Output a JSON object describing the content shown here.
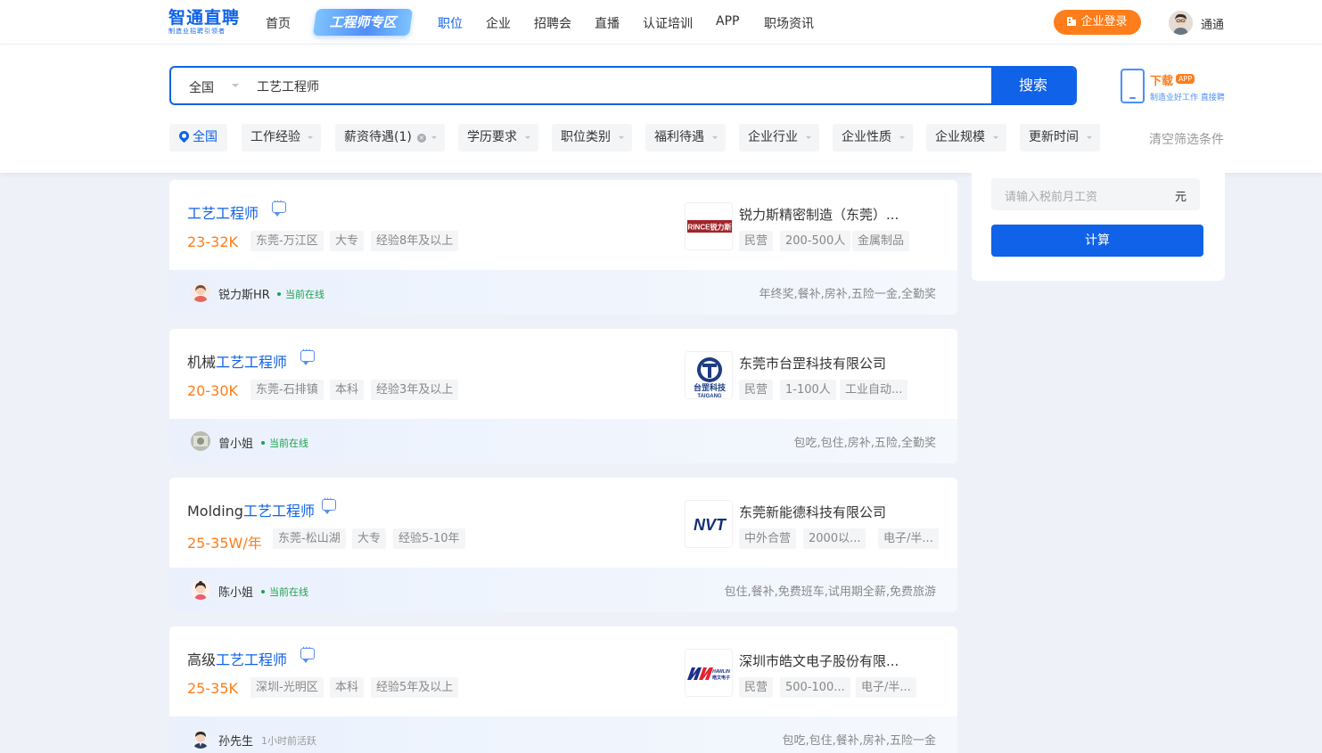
{
  "logo": {
    "main": "智通直聘",
    "sub": "制造业招聘引领者"
  },
  "nav": [
    {
      "label": "首页",
      "active": false
    },
    {
      "label": "职位",
      "active": true
    },
    {
      "label": "企业",
      "active": false
    },
    {
      "label": "招聘会",
      "active": false
    },
    {
      "label": "直播",
      "active": false
    },
    {
      "label": "认证培训",
      "active": false
    },
    {
      "label": "APP",
      "active": false
    },
    {
      "label": "职场资讯",
      "active": false
    }
  ],
  "eng_zone_label": "工程师专区",
  "login_label": "企业登录",
  "user": {
    "name": "通通",
    "avatar_icon": "user-avatar-icon"
  },
  "search": {
    "city": "全国",
    "query": "工艺工程师",
    "button": "搜索"
  },
  "download": {
    "title": "下载",
    "badge": "APP",
    "sub": "制造业好工作 直接聘"
  },
  "filters": [
    {
      "label": "全国",
      "active": true
    },
    {
      "label": "工作经验"
    },
    {
      "label": "薪资待遇(1)",
      "clearable": true
    },
    {
      "label": "学历要求"
    },
    {
      "label": "职位类别"
    },
    {
      "label": "福利待遇"
    },
    {
      "label": "企业行业"
    },
    {
      "label": "企业性质"
    },
    {
      "label": "企业规模"
    },
    {
      "label": "更新时间"
    }
  ],
  "clear_filters": "清空筛选条件",
  "jobs": [
    {
      "title_prefix": "",
      "title_highlight": "工艺工程师",
      "salary": "23-32K",
      "tags": [
        "东莞-万江区",
        "大专",
        "经验8年及以上"
      ],
      "company": "锐力斯精密制造（东莞）...",
      "company_tags": [
        "民营",
        "200-500人",
        "金属制品"
      ],
      "logo_text": "RINCE锐力斯",
      "hr_name": "锐力斯HR",
      "status": "当前在线",
      "status_type": "online",
      "welfare": "年终奖,餐补,房补,五险一金,全勤奖"
    },
    {
      "title_prefix": "机械",
      "title_highlight": "工艺工程师",
      "salary": "20-30K",
      "tags": [
        "东莞-石排镇",
        "本科",
        "经验3年及以上"
      ],
      "company": "东莞市台罡科技有限公司",
      "company_tags": [
        "民营",
        "1-100人",
        "工业自动..."
      ],
      "logo_text": "台罡科技",
      "logo_sub": "TAIGANG",
      "hr_name": "曾小姐",
      "status": "当前在线",
      "status_type": "online",
      "welfare": "包吃,包住,房补,五险,全勤奖"
    },
    {
      "title_prefix": "Molding",
      "title_highlight": "工艺工程师",
      "salary": "25-35W/年",
      "tags": [
        "东莞-松山湖",
        "大专",
        "经验5-10年"
      ],
      "company": "东莞新能德科技有限公司",
      "company_tags": [
        "中外合营",
        "2000以...",
        "电子/半..."
      ],
      "logo_text": "NVT",
      "hr_name": "陈小姐",
      "status": "当前在线",
      "status_type": "online",
      "welfare": "包住,餐补,免费班车,试用期全薪,免费旅游"
    },
    {
      "title_prefix": "高级",
      "title_highlight": "工艺工程师",
      "salary": "25-35K",
      "tags": [
        "深圳-光明区",
        "本科",
        "经验5年及以上"
      ],
      "company": "深圳市皓文电子股份有限...",
      "company_tags": [
        "民营",
        "500-100...",
        "电子/半..."
      ],
      "logo_text": "HAWLIN",
      "logo_sub": "皓文电子",
      "hr_name": "孙先生",
      "status": "1小时前活跃",
      "status_type": "recent",
      "welfare": "包吃,包住,餐补,房补,五险一金"
    }
  ],
  "calculator": {
    "placeholder": "请输入税前月工资",
    "unit": "元",
    "button": "计算"
  },
  "colors": {
    "brand": "#1062e8",
    "accent": "#ff7d1a",
    "online": "#1da34d"
  }
}
